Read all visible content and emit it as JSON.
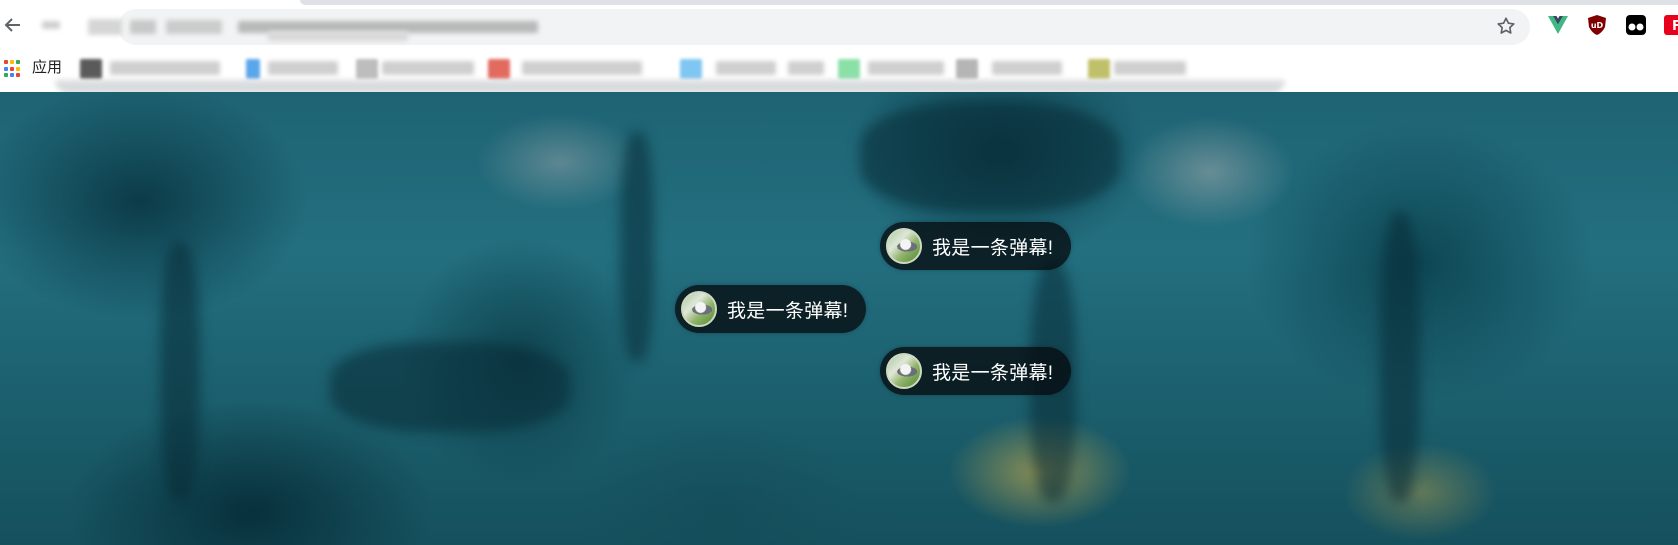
{
  "browser": {
    "back_label": "←",
    "forward_label": "→",
    "url": "",
    "star_label": "☆",
    "extensions": [
      {
        "name": "vue-devtools",
        "color": "#41b883"
      },
      {
        "name": "ublock-origin",
        "label": "uD",
        "color": "#800000"
      },
      {
        "name": "tampermonkey",
        "color": "#000000"
      },
      {
        "name": "red-extension",
        "label": "F",
        "color": "#e8001c"
      }
    ]
  },
  "bookmarks_bar": {
    "apps_label": "应用",
    "apps_dot_colors": [
      "#ea4335",
      "#fbbc05",
      "#34a853",
      "#4285f4",
      "#ea4335",
      "#fbbc05",
      "#34a853",
      "#4285f4",
      "#ea4335"
    ]
  },
  "danmaku": [
    {
      "text": "我是一条弹幕!"
    },
    {
      "text": "我是一条弹幕!"
    },
    {
      "text": "我是一条弹幕!"
    }
  ]
}
